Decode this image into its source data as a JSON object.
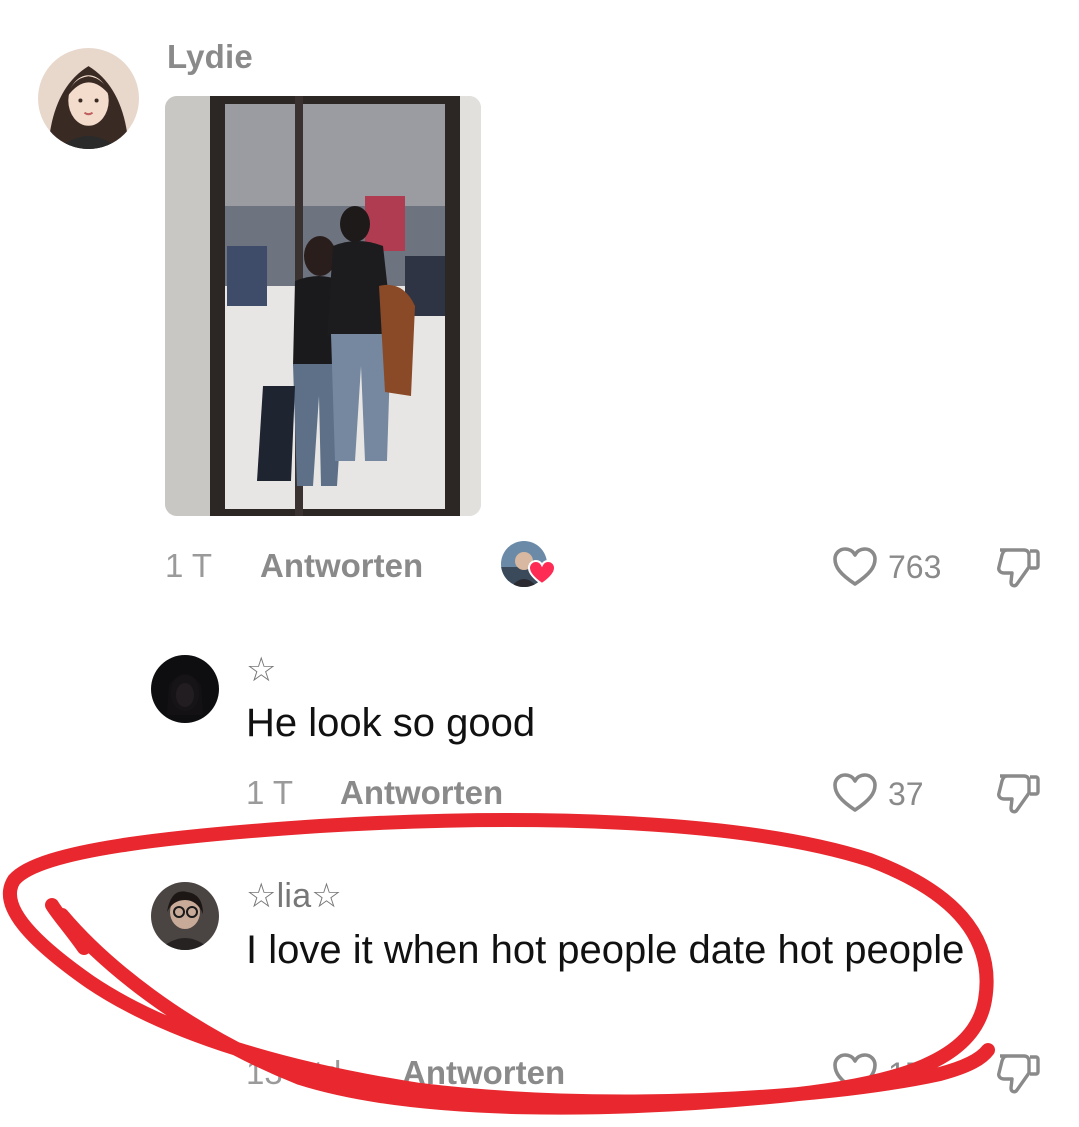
{
  "comments": [
    {
      "username": "Lydie",
      "time": "1 T",
      "reply_label": "Antworten",
      "likes": "763"
    },
    {
      "username": "☆",
      "text": "He look so good",
      "time": "1 T",
      "reply_label": "Antworten",
      "likes": "37"
    },
    {
      "username": "☆lia☆",
      "text": "I love it when hot people date hot people",
      "time": "13 Std.",
      "reply_label": "Antworten",
      "likes": "17"
    }
  ],
  "annotation": {
    "color": "#e8282e",
    "shape": "hand-drawn ellipse around third comment"
  },
  "colors": {
    "heart_badge": "#fe2c55",
    "meta_gray": "#8a8a8a"
  }
}
